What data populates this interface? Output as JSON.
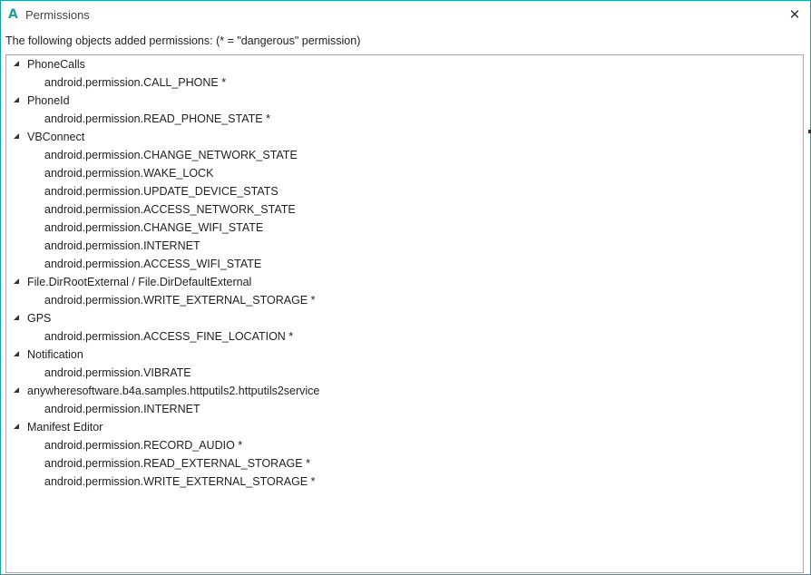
{
  "window": {
    "title": "Permissions",
    "app_icon": "A",
    "close_icon": "✕",
    "accent_color": "#1ba1a1"
  },
  "description": "The following objects added permissions: (* = \"dangerous\" permission)",
  "groups": [
    {
      "name": "PhoneCalls",
      "permissions": [
        "android.permission.CALL_PHONE *"
      ]
    },
    {
      "name": "PhoneId",
      "permissions": [
        "android.permission.READ_PHONE_STATE *"
      ]
    },
    {
      "name": "VBConnect",
      "permissions": [
        "android.permission.CHANGE_NETWORK_STATE",
        "android.permission.WAKE_LOCK",
        "android.permission.UPDATE_DEVICE_STATS",
        "android.permission.ACCESS_NETWORK_STATE",
        "android.permission.CHANGE_WIFI_STATE",
        "android.permission.INTERNET",
        "android.permission.ACCESS_WIFI_STATE"
      ]
    },
    {
      "name": "File.DirRootExternal / File.DirDefaultExternal",
      "permissions": [
        "android.permission.WRITE_EXTERNAL_STORAGE *"
      ]
    },
    {
      "name": "GPS",
      "permissions": [
        "android.permission.ACCESS_FINE_LOCATION *"
      ]
    },
    {
      "name": "Notification",
      "permissions": [
        "android.permission.VIBRATE"
      ]
    },
    {
      "name": "anywheresoftware.b4a.samples.httputils2.httputils2service",
      "permissions": [
        "android.permission.INTERNET"
      ]
    },
    {
      "name": "Manifest Editor",
      "permissions": [
        "android.permission.RECORD_AUDIO *",
        "android.permission.READ_EXTERNAL_STORAGE *",
        "android.permission.WRITE_EXTERNAL_STORAGE *"
      ]
    }
  ]
}
